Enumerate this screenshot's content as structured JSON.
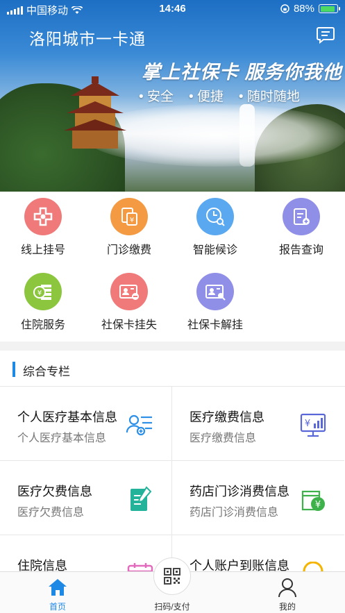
{
  "status_bar": {
    "carrier": "中国移动",
    "time": "14:46",
    "battery": "88%"
  },
  "header": {
    "title": "洛阳城市一卡通",
    "message_icon": "chat-icon"
  },
  "banner": {
    "headline": "掌上社保卡 服务你我他",
    "tags": [
      "安全",
      "便捷",
      "随时随地"
    ]
  },
  "services": [
    {
      "label": "线上挂号",
      "icon": "hospital-cross-icon",
      "color": "#f07a7a"
    },
    {
      "label": "门诊缴费",
      "icon": "payment-receipt-icon",
      "color": "#f39a43"
    },
    {
      "label": "智能候诊",
      "icon": "clock-search-icon",
      "color": "#5aa9f0"
    },
    {
      "label": "报告查询",
      "icon": "report-clipboard-icon",
      "color": "#8f8fe8"
    },
    {
      "label": "住院服务",
      "icon": "coins-icon",
      "color": "#8cc63f"
    },
    {
      "label": "社保卡挂失",
      "icon": "card-minus-icon",
      "color": "#f07a7a"
    },
    {
      "label": "社保卡解挂",
      "icon": "card-search-icon",
      "color": "#8f8fe8"
    }
  ],
  "section": {
    "title": "综合专栏"
  },
  "tiles": [
    {
      "title": "个人医疗基本信息",
      "subtitle": "个人医疗基本信息",
      "icon": "person-list-icon"
    },
    {
      "title": "医疗缴费信息",
      "subtitle": "医疗缴费信息",
      "icon": "yen-monitor-icon"
    },
    {
      "title": "医疗欠费信息",
      "subtitle": "医疗欠费信息",
      "icon": "notepad-pen-icon"
    },
    {
      "title": "药店门诊消费信息",
      "subtitle": "药店门诊消费信息",
      "icon": "wallet-yen-icon"
    },
    {
      "title": "住院信息",
      "subtitle": "",
      "icon": "calendar-icon"
    },
    {
      "title": "个人账户到账信息",
      "subtitle": "",
      "icon": "account-icon"
    }
  ],
  "tabbar": {
    "home": "首页",
    "scan": "扫码/支付",
    "mine": "我的"
  },
  "colors": {
    "accent": "#1e88e5"
  }
}
